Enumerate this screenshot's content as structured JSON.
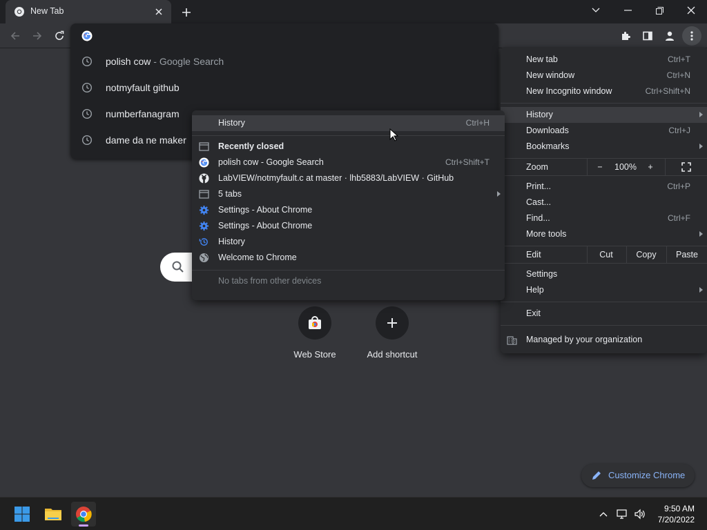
{
  "browser": {
    "tab": {
      "title": "New Tab"
    }
  },
  "omnibox": {
    "value": "",
    "suggestions": [
      {
        "text": "polish cow",
        "suffix": " - Google Search"
      },
      {
        "text": "notmyfault github",
        "suffix": ""
      },
      {
        "text": "numberfanagram",
        "suffix": ""
      },
      {
        "text": "dame da ne maker",
        "suffix": ""
      }
    ]
  },
  "ntp": {
    "shortcuts": [
      {
        "label": "Web Store"
      },
      {
        "label": "Add shortcut"
      }
    ],
    "customize_label": "Customize Chrome"
  },
  "main_menu": {
    "new_tab": {
      "label": "New tab",
      "shortcut": "Ctrl+T"
    },
    "new_window": {
      "label": "New window",
      "shortcut": "Ctrl+N"
    },
    "new_incognito": {
      "label": "New Incognito window",
      "shortcut": "Ctrl+Shift+N"
    },
    "history": {
      "label": "History"
    },
    "downloads": {
      "label": "Downloads",
      "shortcut": "Ctrl+J"
    },
    "bookmarks": {
      "label": "Bookmarks"
    },
    "zoom": {
      "label": "Zoom",
      "minus": "−",
      "value": "100%",
      "plus": "+"
    },
    "print": {
      "label": "Print...",
      "shortcut": "Ctrl+P"
    },
    "cast": {
      "label": "Cast..."
    },
    "find": {
      "label": "Find...",
      "shortcut": "Ctrl+F"
    },
    "more_tools": {
      "label": "More tools"
    },
    "edit": {
      "label": "Edit",
      "cut": "Cut",
      "copy": "Copy",
      "paste": "Paste"
    },
    "settings": {
      "label": "Settings"
    },
    "help": {
      "label": "Help"
    },
    "exit": {
      "label": "Exit"
    },
    "managed": {
      "label": "Managed by your organization"
    }
  },
  "history_menu": {
    "history": {
      "label": "History",
      "shortcut": "Ctrl+H"
    },
    "recently_closed": {
      "label": "Recently closed"
    },
    "items": [
      {
        "label": "polish cow - Google Search",
        "shortcut": "Ctrl+Shift+T",
        "icon": "google-icon"
      },
      {
        "label": "LabVIEW/notmyfault.c at master · lhb5883/LabVIEW · GitHub",
        "shortcut": "",
        "icon": "github-icon"
      },
      {
        "label": "5 tabs",
        "shortcut": "",
        "icon": "window-icon"
      },
      {
        "label": "Settings - About Chrome",
        "shortcut": "",
        "icon": "settings-gear-icon"
      },
      {
        "label": "Settings - About Chrome",
        "shortcut": "",
        "icon": "settings-gear-icon"
      },
      {
        "label": "History",
        "shortcut": "",
        "icon": "history-icon"
      },
      {
        "label": "Welcome to Chrome",
        "shortcut": "",
        "icon": "globe-icon"
      }
    ],
    "no_tabs": {
      "label": "No tabs from other devices"
    }
  },
  "taskbar": {
    "time": "9:50 AM",
    "date": "7/20/2022"
  },
  "colors": {
    "accent": "#8ab4f8",
    "menu_bg": "#292a2d",
    "frame": "#202124",
    "toolbar": "#35363a"
  }
}
